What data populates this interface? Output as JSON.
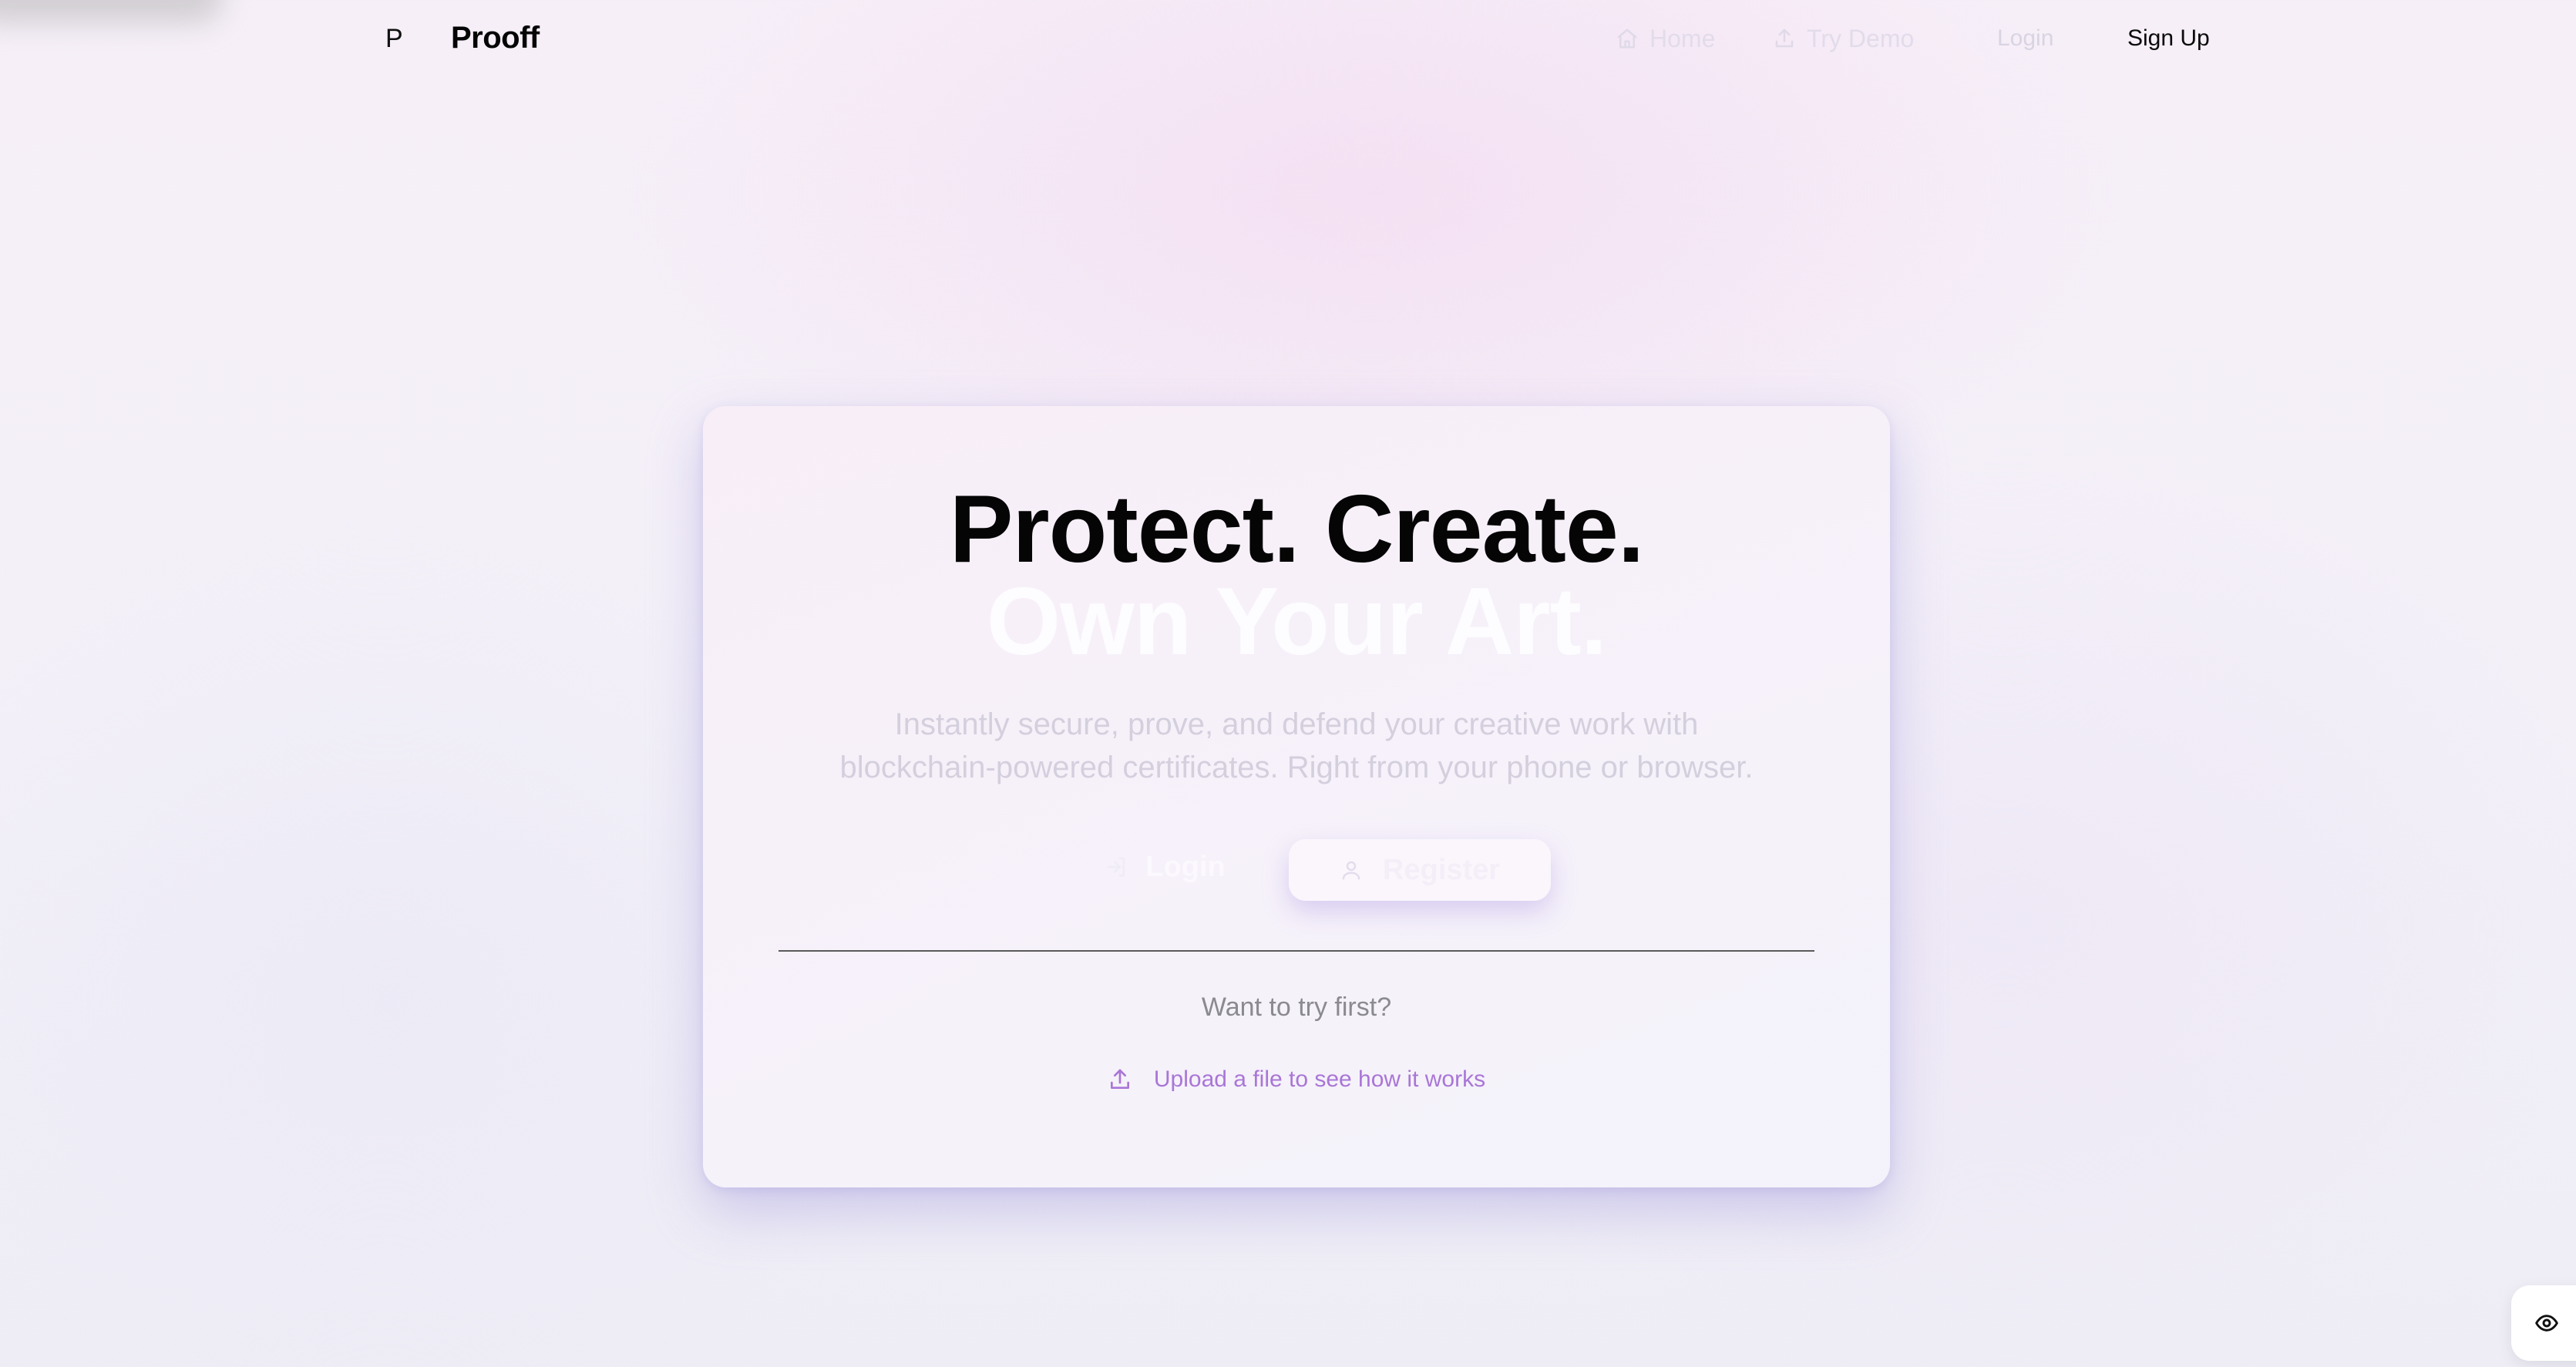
{
  "nav": {
    "logo_mark": "P",
    "brand": "Prooff",
    "links": [
      {
        "label": "Home",
        "icon": "home-icon"
      },
      {
        "label": "Try Demo",
        "icon": "upload-icon"
      }
    ],
    "login_label": "Login",
    "signup_label": "Sign Up"
  },
  "hero": {
    "headline_1": "Protect. Create.",
    "headline_2": "Own Your Art.",
    "subtitle_line_1": "Instantly secure, prove, and defend your creative work with",
    "subtitle_line_2": "blockchain-powered certificates. Right from your phone or browser.",
    "login_button": "Login",
    "register_button": "Register",
    "try_first": "Want to try first?",
    "upload_link": "Upload a file to see how it works"
  },
  "colors": {
    "accent": "#a976d6",
    "text_dark": "#050505",
    "muted": "#8a8a8f"
  },
  "floating_button": {
    "icon": "eye-icon"
  }
}
